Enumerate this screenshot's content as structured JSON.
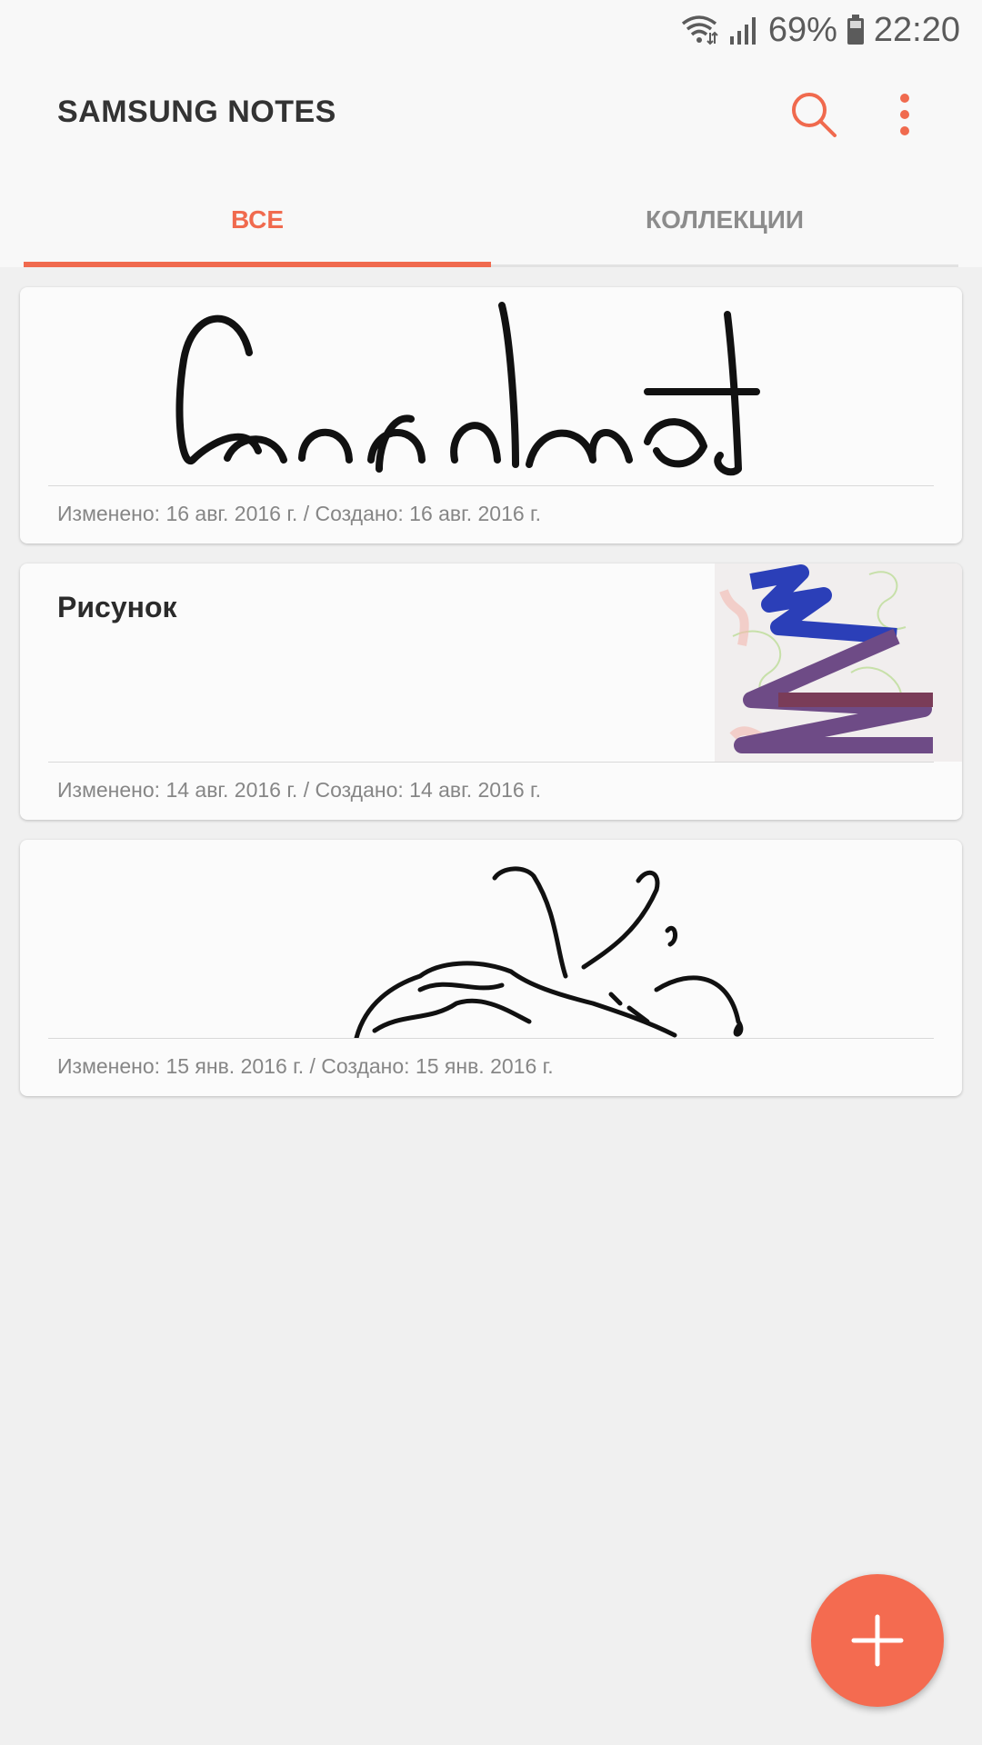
{
  "status_bar": {
    "battery": "69%",
    "time": "22:20",
    "icons": [
      "wifi-icon",
      "signal-icon",
      "battery-icon"
    ]
  },
  "app_bar": {
    "title": "SAMSUNG NOTES",
    "icons": [
      "search-icon",
      "more-vert-icon"
    ]
  },
  "tabs": [
    {
      "label": "ВСЕ",
      "active": true
    },
    {
      "label": "КОЛЛЕКЦИИ",
      "active": false
    }
  ],
  "notes": [
    {
      "title": "",
      "meta": "Изменено: 16 авг. 2016 г. / Создано: 16 авг. 2016 г.",
      "preview": "handwriting-drawing"
    },
    {
      "title": "Рисунок",
      "meta": "Изменено: 14 авг. 2016 г. / Создано: 14 авг. 2016 г.",
      "preview": "color-scribble-thumbnail"
    },
    {
      "title": "",
      "meta": "Изменено: 15 янв. 2016 г. / Создано: 15 янв. 2016 г.",
      "preview": "line-sketch-drawing"
    }
  ],
  "fab": {
    "icon": "plus-icon"
  },
  "colors": {
    "accent": "#f06a4e",
    "background": "#f0f0f0",
    "card": "#fbfbfb"
  }
}
